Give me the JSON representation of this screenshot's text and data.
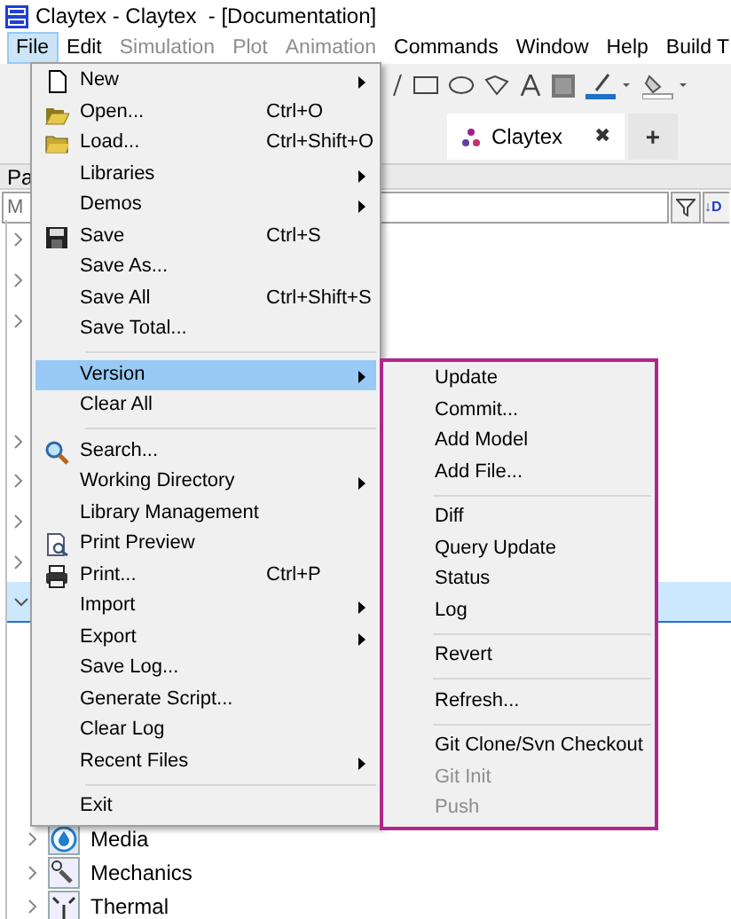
{
  "window": {
    "title": "Claytex - Claytex  - [Documentation]"
  },
  "menubar": [
    {
      "label": "File",
      "selected": true,
      "disabled": false
    },
    {
      "label": "Edit",
      "selected": false,
      "disabled": false
    },
    {
      "label": "Simulation",
      "selected": false,
      "disabled": true
    },
    {
      "label": "Plot",
      "selected": false,
      "disabled": true
    },
    {
      "label": "Animation",
      "selected": false,
      "disabled": true
    },
    {
      "label": "Commands",
      "selected": false,
      "disabled": false
    },
    {
      "label": "Window",
      "selected": false,
      "disabled": false
    },
    {
      "label": "Help",
      "selected": false,
      "disabled": false
    },
    {
      "label": "Build T",
      "selected": false,
      "disabled": false
    }
  ],
  "document_tab": {
    "label": "Claytex",
    "close": "✖",
    "add": "+"
  },
  "panel": {
    "title": "Pa"
  },
  "search": {
    "placeholder": "M",
    "sort_label": "↓D"
  },
  "tree": {
    "rows": [
      {
        "kind": "folder",
        "expanded": false,
        "selected": false
      },
      {
        "kind": "folder",
        "expanded": false,
        "selected": false
      },
      {
        "kind": "folder",
        "expanded": false,
        "selected": false
      },
      {
        "kind": "leaf",
        "selected": false
      },
      {
        "kind": "leaf",
        "selected": false
      },
      {
        "kind": "folder",
        "expanded": false,
        "selected": false
      },
      {
        "kind": "folder",
        "expanded": false,
        "selected": false
      },
      {
        "kind": "folder",
        "expanded": false,
        "selected": false
      },
      {
        "kind": "folder",
        "expanded": false,
        "selected": false
      },
      {
        "kind": "folder",
        "expanded": true,
        "selected": true
      }
    ],
    "children": [
      {
        "label": "Media",
        "expanded": false
      },
      {
        "label": "Mechanics",
        "expanded": false
      },
      {
        "label": "Thermal",
        "expanded": false
      }
    ]
  },
  "file_menu": [
    {
      "kind": "item",
      "label": "New",
      "submenu": true,
      "selected": false
    },
    {
      "kind": "item",
      "label": "Open...",
      "shortcut": "Ctrl+O",
      "submenu": false,
      "selected": false
    },
    {
      "kind": "item",
      "label": "Load...",
      "shortcut": "Ctrl+Shift+O",
      "submenu": false,
      "selected": false
    },
    {
      "kind": "item",
      "label": "Libraries",
      "submenu": true,
      "selected": false
    },
    {
      "kind": "item",
      "label": "Demos",
      "submenu": true,
      "selected": false
    },
    {
      "kind": "item",
      "label": "Save",
      "shortcut": "Ctrl+S",
      "submenu": false,
      "selected": false
    },
    {
      "kind": "item",
      "label": "Save As...",
      "submenu": false,
      "selected": false
    },
    {
      "kind": "item",
      "label": "Save All",
      "shortcut": "Ctrl+Shift+S",
      "submenu": false,
      "selected": false
    },
    {
      "kind": "item",
      "label": "Save Total...",
      "submenu": false,
      "selected": false
    },
    {
      "kind": "separator"
    },
    {
      "kind": "item",
      "label": "Version",
      "submenu": true,
      "selected": true
    },
    {
      "kind": "item",
      "label": "Clear All",
      "submenu": false,
      "selected": false
    },
    {
      "kind": "separator"
    },
    {
      "kind": "item",
      "label": "Search...",
      "submenu": false,
      "selected": false
    },
    {
      "kind": "item",
      "label": "Working Directory",
      "submenu": true,
      "selected": false
    },
    {
      "kind": "item",
      "label": "Library Management",
      "submenu": false,
      "selected": false
    },
    {
      "kind": "item",
      "label": "Print Preview",
      "submenu": false,
      "selected": false
    },
    {
      "kind": "item",
      "label": "Print...",
      "shortcut": "Ctrl+P",
      "submenu": false,
      "selected": false
    },
    {
      "kind": "item",
      "label": "Import",
      "submenu": true,
      "selected": false
    },
    {
      "kind": "item",
      "label": "Export",
      "submenu": true,
      "selected": false
    },
    {
      "kind": "item",
      "label": "Save Log...",
      "submenu": false,
      "selected": false
    },
    {
      "kind": "item",
      "label": "Generate Script...",
      "submenu": false,
      "selected": false
    },
    {
      "kind": "item",
      "label": "Clear Log",
      "submenu": false,
      "selected": false
    },
    {
      "kind": "item",
      "label": "Recent Files",
      "submenu": true,
      "selected": false
    },
    {
      "kind": "separator"
    },
    {
      "kind": "item",
      "label": "Exit",
      "submenu": false,
      "selected": false
    }
  ],
  "version_menu": [
    {
      "kind": "item",
      "label": "Update",
      "disabled": false
    },
    {
      "kind": "item",
      "label": "Commit...",
      "disabled": false
    },
    {
      "kind": "item",
      "label": "Add Model",
      "disabled": false
    },
    {
      "kind": "item",
      "label": "Add File...",
      "disabled": false
    },
    {
      "kind": "separator"
    },
    {
      "kind": "item",
      "label": "Diff",
      "disabled": false
    },
    {
      "kind": "item",
      "label": "Query Update",
      "disabled": false
    },
    {
      "kind": "item",
      "label": "Status",
      "disabled": false
    },
    {
      "kind": "item",
      "label": "Log",
      "disabled": false
    },
    {
      "kind": "separator"
    },
    {
      "kind": "item",
      "label": "Revert",
      "disabled": false
    },
    {
      "kind": "separator"
    },
    {
      "kind": "item",
      "label": "Refresh...",
      "disabled": false
    },
    {
      "kind": "separator"
    },
    {
      "kind": "item",
      "label": "Git Clone/Svn Checkout",
      "disabled": false
    },
    {
      "kind": "item",
      "label": "Git Init",
      "disabled": true
    },
    {
      "kind": "item",
      "label": "Push",
      "disabled": true
    }
  ]
}
